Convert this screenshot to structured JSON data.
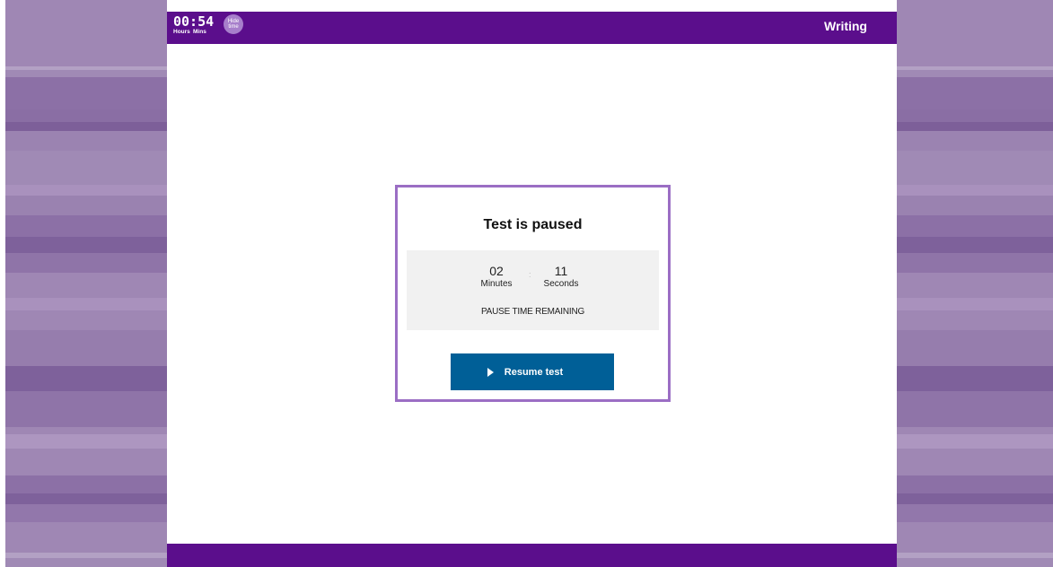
{
  "timer": {
    "value": "00:54",
    "hours_label": "Hours",
    "mins_label": "Mins",
    "hide_button_label": "Hide time"
  },
  "header": {
    "section_title": "Writing"
  },
  "pause_dialog": {
    "title": "Test is paused",
    "countdown": {
      "minutes": "02",
      "minutes_label": "Minutes",
      "separator": ":",
      "seconds": "11",
      "seconds_label": "Seconds",
      "caption": "PAUSE TIME REMAINING"
    },
    "resume_button_label": "Resume test",
    "resume_icon": "play-icon"
  },
  "colors": {
    "brand_purple": "#5b0e8c",
    "dialog_border": "#9b6ec4",
    "button_blue": "#005f97",
    "hide_button_bg": "#a77fcb"
  }
}
